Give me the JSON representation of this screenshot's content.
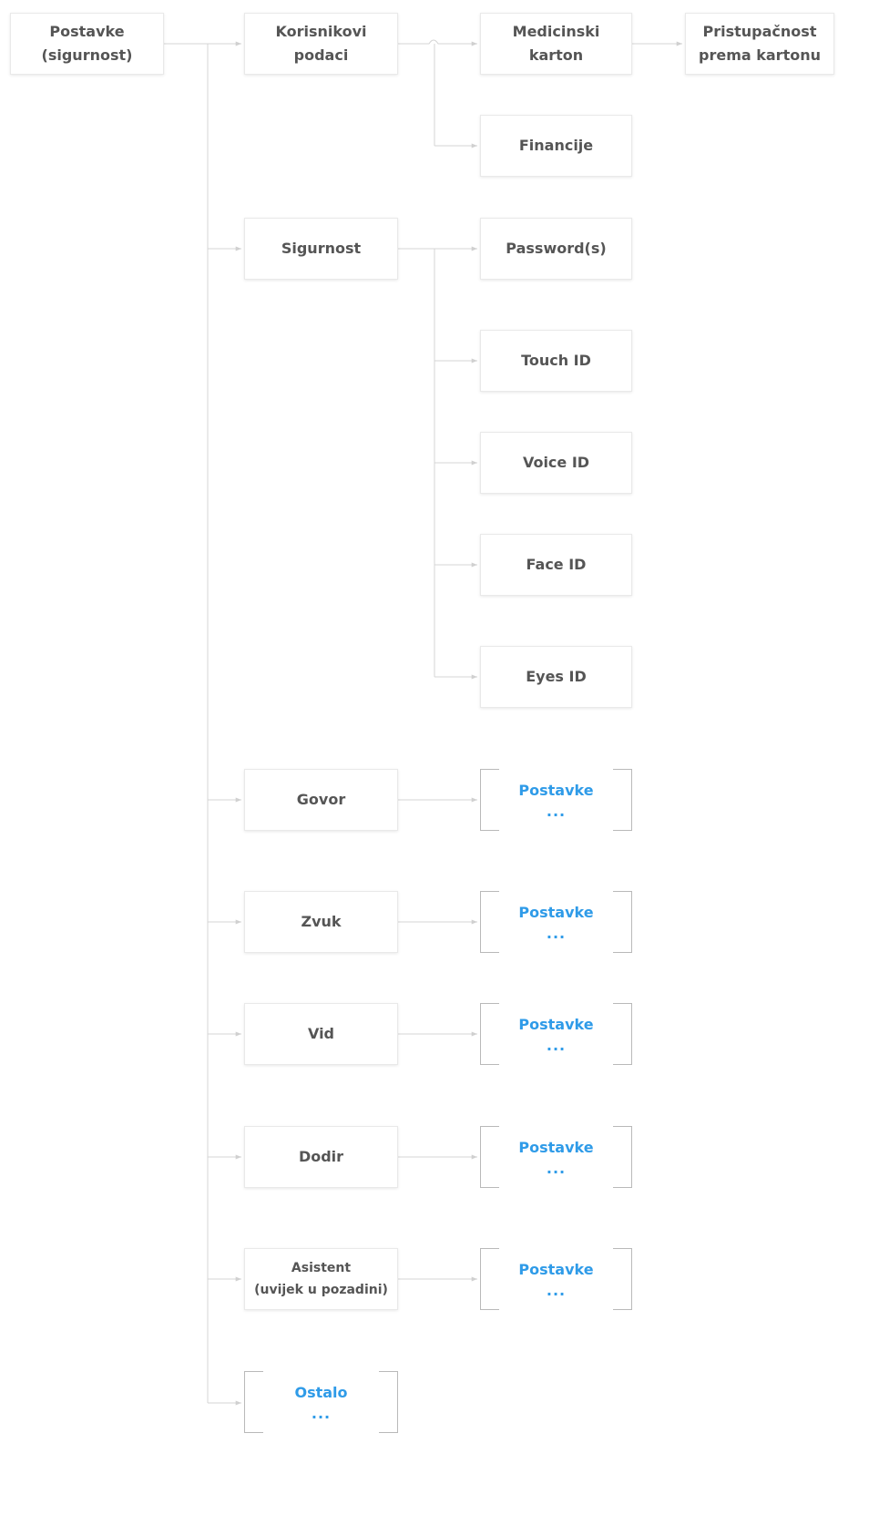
{
  "diagram": {
    "root": {
      "line1": "Postavke",
      "line2": "(sigurnost)"
    },
    "user_data": {
      "line1": "Korisnikovi",
      "line2": "podaci"
    },
    "medical_record": {
      "line1": "Medicinski",
      "line2": "karton"
    },
    "record_access": {
      "line1": "Pristupačnost",
      "line2": "prema kartonu"
    },
    "finance": {
      "label": "Financije"
    },
    "security": {
      "label": "Sigurnost"
    },
    "passwords": {
      "label": "Password(s)"
    },
    "touch_id": {
      "label": "Touch ID"
    },
    "voice_id": {
      "label": "Voice ID"
    },
    "face_id": {
      "label": "Face ID"
    },
    "eyes_id": {
      "label": "Eyes ID"
    },
    "speech": {
      "label": "Govor"
    },
    "sound": {
      "label": "Zvuk"
    },
    "vision": {
      "label": "Vid"
    },
    "touch": {
      "label": "Dodir"
    },
    "assistant": {
      "line1": "Asistent",
      "line2": "(uvijek u pozadini)"
    },
    "settings_placeholder": {
      "label": "Postavke",
      "ellipsis": "..."
    },
    "other": {
      "label": "Ostalo",
      "ellipsis": "..."
    }
  },
  "colors": {
    "node_text": "#555555",
    "link_text": "#2f9be8",
    "connector": "#cfcfcf",
    "node_border": "#e9e9e9"
  }
}
